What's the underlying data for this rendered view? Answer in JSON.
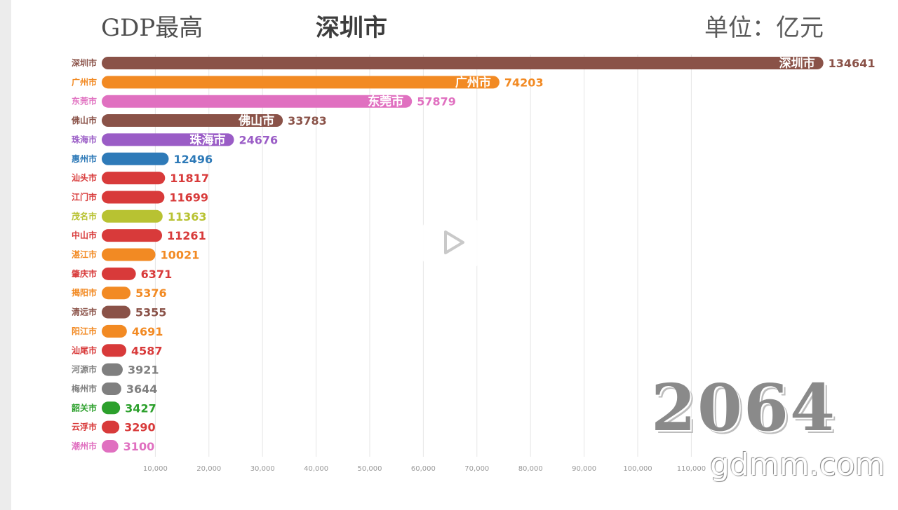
{
  "header": {
    "left": "GDP最高",
    "center": "深圳市",
    "right": "单位：亿元"
  },
  "year_label": "2064",
  "watermark": "gdmm.com",
  "icons": {
    "play": "play-icon"
  },
  "chart_data": {
    "type": "bar",
    "orientation": "horizontal",
    "title": "深圳市",
    "unit": "单位：亿元",
    "xlim": [
      0,
      140000
    ],
    "grid": true,
    "ticks": [
      "10,000",
      "20,000",
      "30,000",
      "40,000",
      "50,000",
      "60,000",
      "70,000",
      "80,000",
      "90,000",
      "100,000",
      "110,000"
    ],
    "bars": [
      {
        "label": "深圳市",
        "value": 134641,
        "value_text": "134641",
        "color": "#8a5248",
        "inner": "深圳市"
      },
      {
        "label": "广州市",
        "value": 74203,
        "value_text": "74203",
        "color": "#f28a23",
        "inner": "广州市"
      },
      {
        "label": "东莞市",
        "value": 57879,
        "value_text": "57879",
        "color": "#e070c0",
        "inner": "东莞市"
      },
      {
        "label": "佛山市",
        "value": 33783,
        "value_text": "33783",
        "color": "#8a5248",
        "inner": "佛山市"
      },
      {
        "label": "珠海市",
        "value": 24676,
        "value_text": "24676",
        "color": "#9a5cc6",
        "inner": "珠海市"
      },
      {
        "label": "惠州市",
        "value": 12496,
        "value_text": "12496",
        "color": "#2e7ab8"
      },
      {
        "label": "汕头市",
        "value": 11817,
        "value_text": "11817",
        "color": "#d83a3a"
      },
      {
        "label": "江门市",
        "value": 11699,
        "value_text": "11699",
        "color": "#d83a3a"
      },
      {
        "label": "茂名市",
        "value": 11363,
        "value_text": "11363",
        "color": "#b8c232"
      },
      {
        "label": "中山市",
        "value": 11261,
        "value_text": "11261",
        "color": "#d83a3a"
      },
      {
        "label": "湛江市",
        "value": 10021,
        "value_text": "10021",
        "color": "#f28a23"
      },
      {
        "label": "肇庆市",
        "value": 6371,
        "value_text": "6371",
        "color": "#d83a3a"
      },
      {
        "label": "揭阳市",
        "value": 5376,
        "value_text": "5376",
        "color": "#f28a23"
      },
      {
        "label": "清远市",
        "value": 5355,
        "value_text": "5355",
        "color": "#8a5248"
      },
      {
        "label": "阳江市",
        "value": 4691,
        "value_text": "4691",
        "color": "#f28a23"
      },
      {
        "label": "汕尾市",
        "value": 4587,
        "value_text": "4587",
        "color": "#d83a3a"
      },
      {
        "label": "河源市",
        "value": 3921,
        "value_text": "3921",
        "color": "#7f7f7f"
      },
      {
        "label": "梅州市",
        "value": 3644,
        "value_text": "3644",
        "color": "#7f7f7f"
      },
      {
        "label": "韶关市",
        "value": 3427,
        "value_text": "3427",
        "color": "#2ca02c"
      },
      {
        "label": "云浮市",
        "value": 3290,
        "value_text": "3290",
        "color": "#d83a3a"
      },
      {
        "label": "潮州市",
        "value": 3100,
        "value_text": "3100",
        "color": "#e070c0"
      }
    ]
  }
}
